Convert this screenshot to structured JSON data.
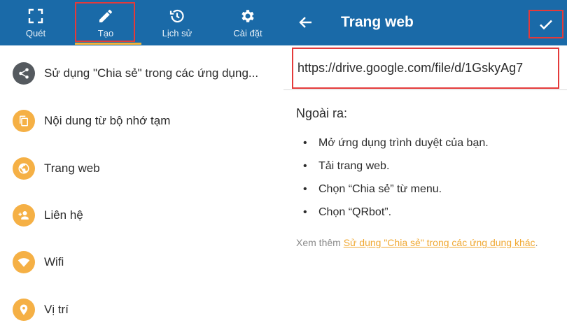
{
  "tabs": [
    {
      "label": "Quét",
      "icon": "scan-icon"
    },
    {
      "label": "Tạo",
      "icon": "pencil-icon"
    },
    {
      "label": "Lịch sử",
      "icon": "history-icon"
    },
    {
      "label": "Cài đặt",
      "icon": "gear-icon"
    }
  ],
  "menu": [
    {
      "label": "Sử dụng \"Chia sẻ\" trong các ứng dụng...",
      "icon": "share-icon"
    },
    {
      "label": "Nội dung từ bộ nhớ tạm",
      "icon": "clipboard-icon"
    },
    {
      "label": "Trang web",
      "icon": "globe-icon"
    },
    {
      "label": "Liên hệ",
      "icon": "add-contact-icon"
    },
    {
      "label": "Wifi",
      "icon": "wifi-icon"
    },
    {
      "label": "Vị trí",
      "icon": "location-icon"
    }
  ],
  "editor": {
    "title": "Trang web",
    "url_value": "https://drive.google.com/file/d/1GskyAg7",
    "also_heading": "Ngoài ra:",
    "steps": [
      "Mở ứng dụng trình duyệt của bạn.",
      "Tải trang web.",
      "Chọn “Chia sẻ” từ menu.",
      "Chọn “QRbot”."
    ],
    "see_also_prefix": "Xem thêm ",
    "see_also_link": "Sử dụng \"Chia sẻ\" trong các ứng dụng khác",
    "see_also_suffix": "."
  },
  "colors": {
    "toolbar": "#1a6aa8",
    "accent": "#f2b43a",
    "highlight": "#e43a3a"
  }
}
